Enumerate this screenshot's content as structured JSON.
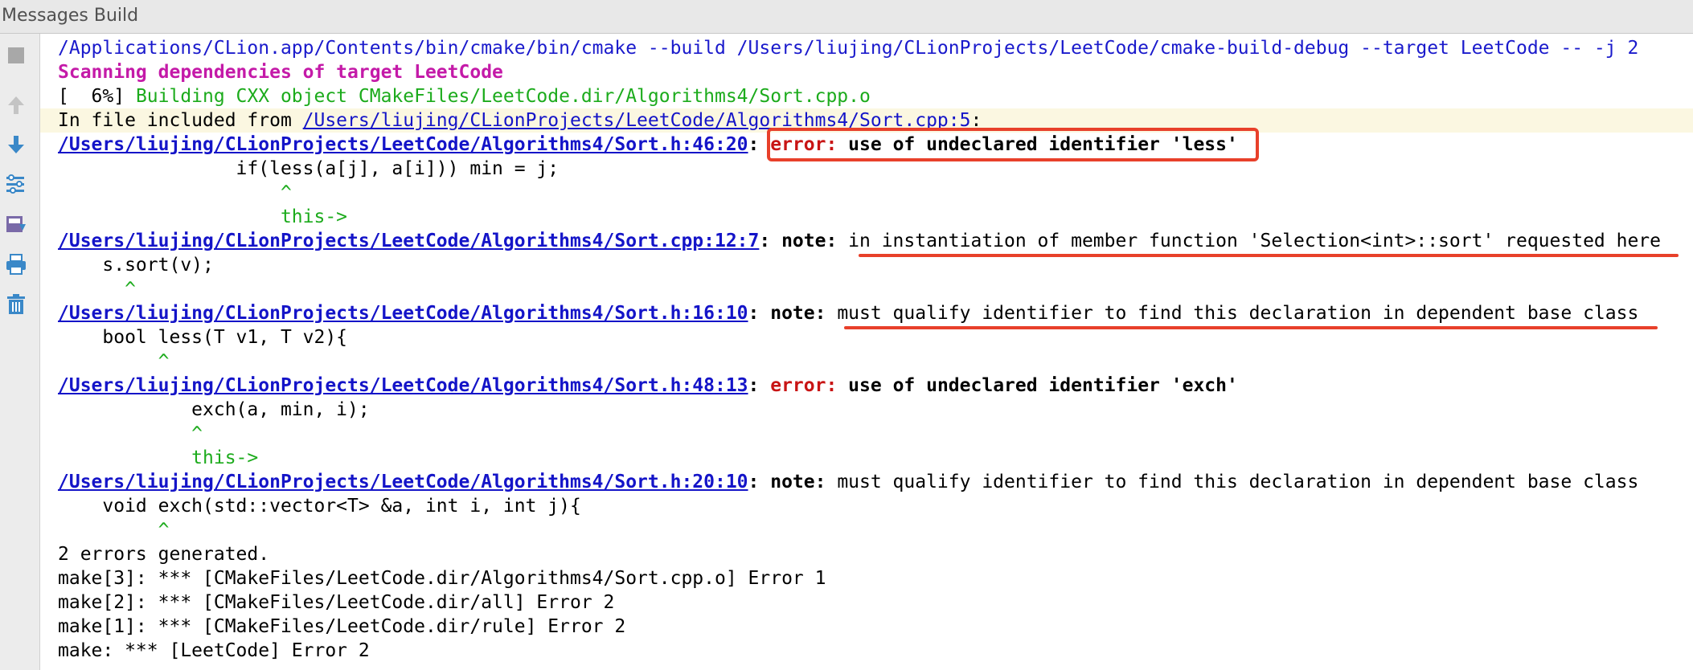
{
  "window": {
    "title": "Messages Build"
  },
  "toolbar": {
    "buttons": [
      {
        "name": "stop-icon",
        "color": "#9a9a9a"
      },
      {
        "name": "arrow-up-icon",
        "color": "#b0b0b0"
      },
      {
        "name": "arrow-down-icon",
        "color": "#3a88c8"
      },
      {
        "name": "filter-settings-icon",
        "color": "#3a88c8"
      },
      {
        "name": "export-icon",
        "color": "#6a4a9a"
      },
      {
        "name": "print-icon",
        "color": "#3a88c8"
      },
      {
        "name": "trash-icon",
        "color": "#3a88c8"
      }
    ]
  },
  "console": {
    "cmd": "/Applications/CLion.app/Contents/bin/cmake/bin/cmake --build /Users/liujing/CLionProjects/LeetCode/cmake-build-debug --target LeetCode -- -j 2",
    "scan": "Scanning dependencies of target LeetCode",
    "build_prefix": "[  6%] ",
    "build_text": "Building CXX object CMakeFiles/LeetCode.dir/Algorithms4/Sort.cpp.o",
    "included_prefix": "In file included from ",
    "included_link": "/Users/liujing/CLionProjects/LeetCode/Algorithms4/Sort.cpp:5",
    "included_suffix": ":",
    "err1_link": "/Users/liujing/CLionProjects/LeetCode/Algorithms4/Sort.h:46:20",
    "err1_colon": ": ",
    "err1_label": "error:",
    "err1_msg": " use of undeclared identifier 'less'",
    "err1_code": "                if(less(a[j], a[i])) min = j;",
    "err1_caret": "                    ^",
    "err1_fixit": "                    this->",
    "note1_link": "/Users/liujing/CLionProjects/LeetCode/Algorithms4/Sort.cpp:12:7",
    "note1_label": ": note: ",
    "note1_msg": "in instantiation of member function 'Selection<int>::sort' requested here",
    "note1_code": "    s.sort(v);",
    "note1_caret": "      ^",
    "note2_link": "/Users/liujing/CLionProjects/LeetCode/Algorithms4/Sort.h:16:10",
    "note2_label": ": note: ",
    "note2_msg": "must qualify identifier to find this declaration in dependent base class",
    "note2_code": "    bool less(T v1, T v2){",
    "note2_caret": "         ^",
    "err2_link": "/Users/liujing/CLionProjects/LeetCode/Algorithms4/Sort.h:48:13",
    "err2_colon": ": ",
    "err2_label": "error:",
    "err2_msg": " use of undeclared identifier 'exch'",
    "err2_code": "            exch(a, min, i);",
    "err2_caret": "            ^",
    "err2_fixit": "            this->",
    "note3_link": "/Users/liujing/CLionProjects/LeetCode/Algorithms4/Sort.h:20:10",
    "note3_label": ": note: ",
    "note3_msg": "must qualify identifier to find this declaration in dependent base class",
    "note3_code": "    void exch(std::vector<T> &a, int i, int j){",
    "note3_caret": "         ^",
    "summary": "2 errors generated.",
    "make3": "make[3]: *** [CMakeFiles/LeetCode.dir/Algorithms4/Sort.cpp.o] Error 1",
    "make2": "make[2]: *** [CMakeFiles/LeetCode.dir/all] Error 2",
    "make1": "make[1]: *** [CMakeFiles/LeetCode.dir/rule] Error 2",
    "make0": "make: *** [LeetCode] Error 2"
  },
  "annotations": {
    "color": "#e8402a"
  }
}
